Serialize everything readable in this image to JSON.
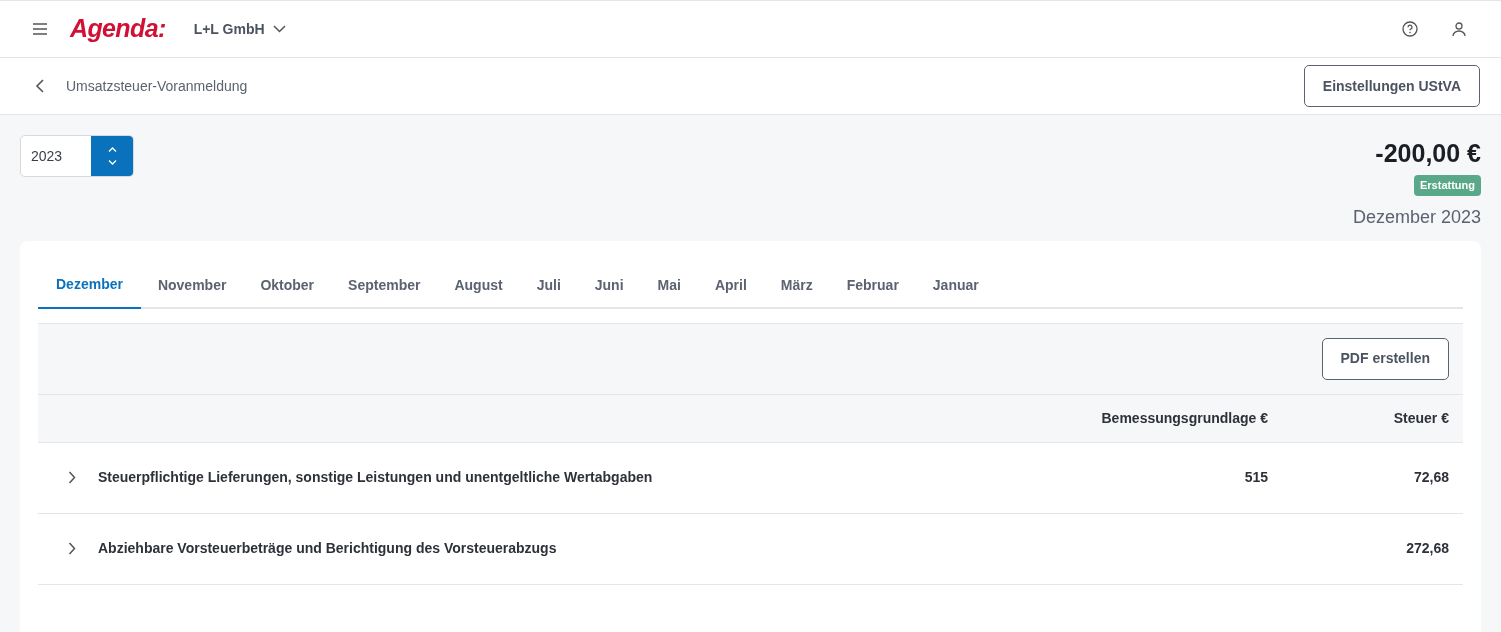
{
  "header": {
    "logo": "Agenda:",
    "company": "L+L GmbH"
  },
  "subheader": {
    "title": "Umsatzsteuer-Voranmeldung",
    "settings_button": "Einstellungen UStVA"
  },
  "year_field": {
    "value": "2023"
  },
  "summary": {
    "amount": "-200,00 €",
    "badge": "Erstattung",
    "period": "Dezember 2023"
  },
  "tabs": [
    {
      "label": "Dezember",
      "selected": true
    },
    {
      "label": "November",
      "selected": false
    },
    {
      "label": "Oktober",
      "selected": false
    },
    {
      "label": "September",
      "selected": false
    },
    {
      "label": "August",
      "selected": false
    },
    {
      "label": "Juli",
      "selected": false
    },
    {
      "label": "Juni",
      "selected": false
    },
    {
      "label": "Mai",
      "selected": false
    },
    {
      "label": "April",
      "selected": false
    },
    {
      "label": "März",
      "selected": false
    },
    {
      "label": "Februar",
      "selected": false
    },
    {
      "label": "Januar",
      "selected": false
    }
  ],
  "pdf_button": "PDF erstellen",
  "table": {
    "columns": [
      "Bemessungsgrundlage €",
      "Steuer €"
    ],
    "rows": [
      {
        "label": "Steuerpflichtige Lieferungen, sonstige Leistungen und unentgeltliche Wertabgaben",
        "base": "515",
        "tax": "72,68",
        "expanded": false
      },
      {
        "label": "Abziehbare Vorsteuerbeträge und Berichtigung des Vorsteuerabzugs",
        "tax": "272,68",
        "expanded": false
      }
    ]
  }
}
